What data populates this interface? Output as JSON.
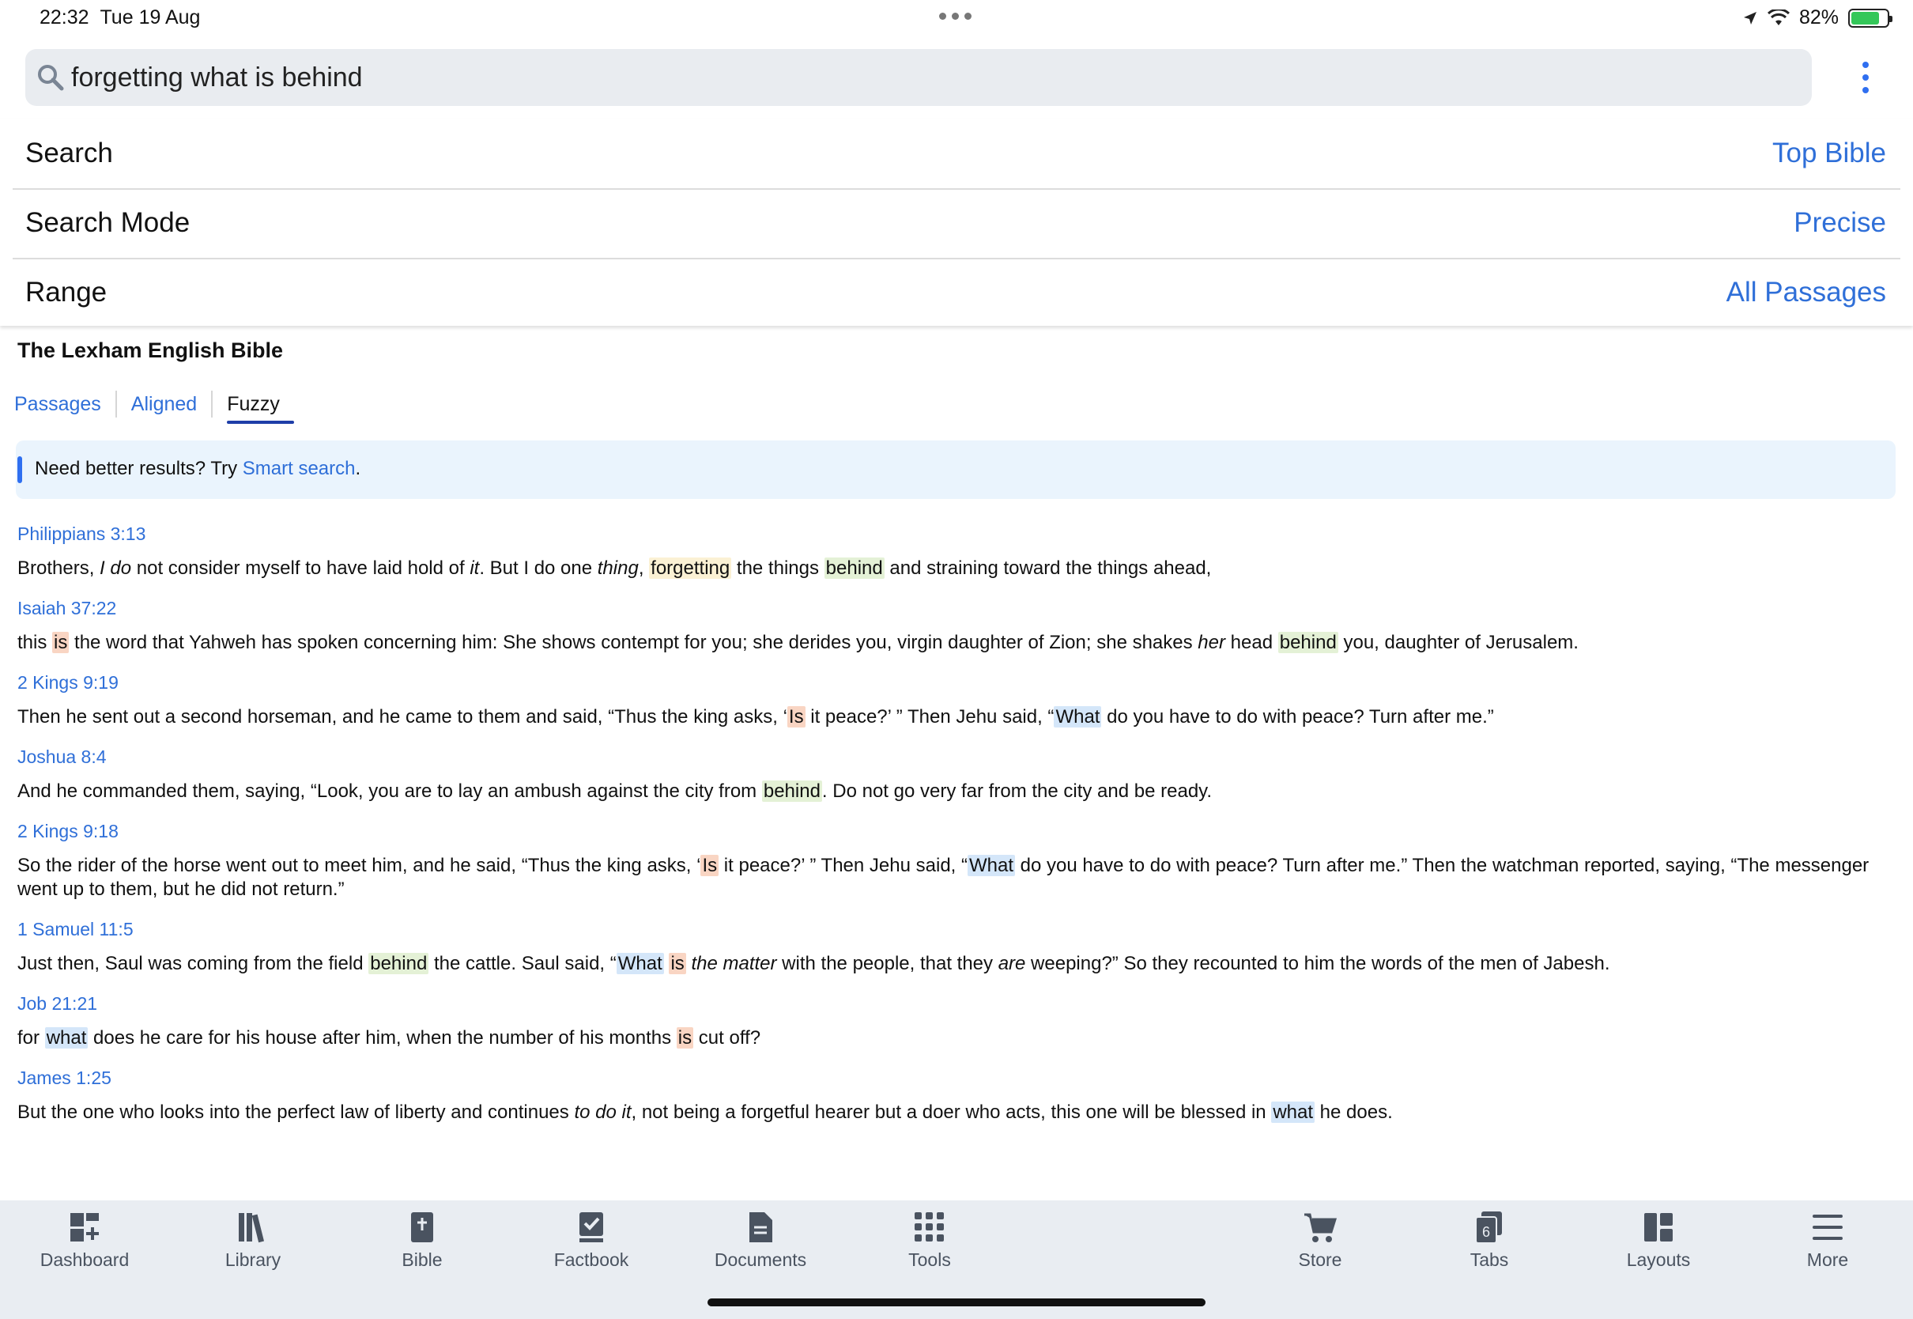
{
  "status_bar": {
    "time": "22:32",
    "date": "Tue 19 Aug",
    "battery": "82%"
  },
  "search": {
    "value": "forgetting what is behind",
    "placeholder": ""
  },
  "settings": [
    {
      "label": "Search",
      "value": "Top Bible"
    },
    {
      "label": "Search Mode",
      "value": "Precise"
    },
    {
      "label": "Range",
      "value": "All Passages"
    }
  ],
  "results_header": {
    "title": "The Lexham English Bible",
    "tabs": [
      "Passages",
      "Aligned",
      "Fuzzy"
    ],
    "active_tab": "Fuzzy"
  },
  "banner": {
    "text": "Need better results? Try ",
    "link": "Smart search",
    "suffix": "."
  },
  "results": [
    {
      "ref": "Philippians 3:13",
      "verse": "Brothers, I do not consider myself to have laid hold of it. But I do one thing, forgetting the things behind and straining toward the things ahead,"
    },
    {
      "ref": "Isaiah 37:22",
      "verse": "this is the word that Yahweh has spoken concerning him: She shows contempt for you; she derides you, virgin daughter of Zion; she shakes her head behind you, daughter of Jerusalem."
    },
    {
      "ref": "2 Kings 9:19",
      "verse": "Then he sent out a second horseman, and he came to them and said, “Thus the king asks, ‘Is it peace?’ ” Then Jehu said, “What do you have to do with peace? Turn after me.”"
    },
    {
      "ref": "Joshua 8:4",
      "verse": "And he commanded them, saying, “Look, you are to lay an ambush against the city from behind. Do not go very far from the city and be ready."
    },
    {
      "ref": "2 Kings 9:18",
      "verse": "So the rider of the horse went out to meet him, and he said, “Thus the king asks, ‘Is it peace?’ ” Then Jehu said, “What do you have to do with peace? Turn after me.” Then the watchman reported, saying, “The messenger went up to them, but he did not return.”"
    },
    {
      "ref": "1 Samuel 11:5",
      "verse": "Just then, Saul was coming from the field behind the cattle. Saul said, “What is the matter with the people, that they are weeping?” So they recounted to him the words of the men of Jabesh."
    },
    {
      "ref": "Job 21:21",
      "verse": "for what does he care for his house after him, when the number of his months is cut off?"
    },
    {
      "ref": "James 1:25",
      "verse": "But the one who looks into the perfect law of liberty and continues to do it, not being a forgetful hearer but a doer who acts, this one will be blessed in what he does."
    }
  ],
  "highlight_colors": {
    "forgetting": "#fbf1d4",
    "behind": "#e4f1d6",
    "is": "#f9d5c3",
    "what": "#d4e6f9"
  },
  "toolbar": [
    {
      "label": "Dashboard",
      "icon": "dashboard-icon"
    },
    {
      "label": "Library",
      "icon": "library-icon"
    },
    {
      "label": "Bible",
      "icon": "bible-icon"
    },
    {
      "label": "Factbook",
      "icon": "factbook-icon"
    },
    {
      "label": "Documents",
      "icon": "documents-icon"
    },
    {
      "label": "Tools",
      "icon": "tools-icon"
    },
    {
      "label": "Store",
      "icon": "cart-icon"
    },
    {
      "label": "Tabs",
      "icon": "tabs-icon",
      "badge": "6"
    },
    {
      "label": "Layouts",
      "icon": "layouts-icon"
    },
    {
      "label": "More",
      "icon": "menu-icon"
    }
  ],
  "colors": {
    "accent": "#2f6fd8",
    "toolbar_bg": "#e9edf2",
    "banner_bg": "#eaf4fd"
  }
}
